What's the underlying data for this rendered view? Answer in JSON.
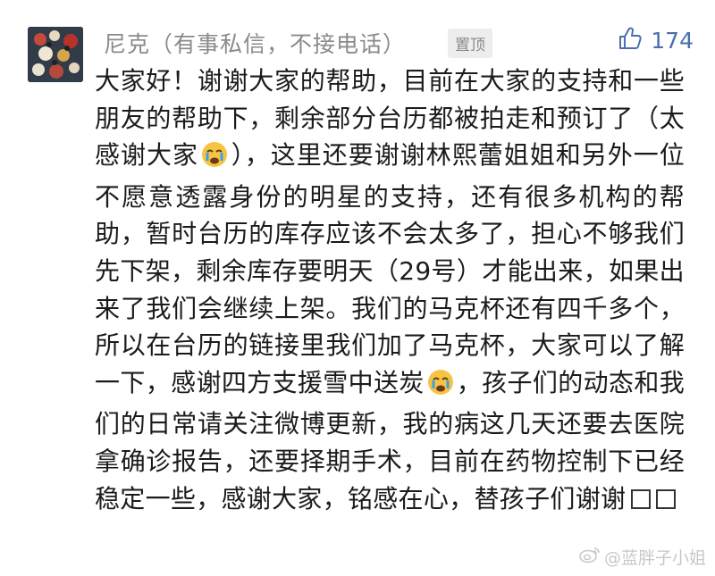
{
  "comment": {
    "author": {
      "name": "尼克（有事私信，不接电话）",
      "avatar_icon": "avatar-image"
    },
    "pin_label": "置顶",
    "likes": {
      "icon": "thumbs-up-icon",
      "count": "174"
    },
    "body_parts": [
      "大家好！谢谢大家的帮助，目前在大家的支持和一些朋友的帮助下，剩余部分台历都被拍走和预订了（太感谢大家",
      "），这里还要谢谢林熙蕾姐姐和另外一位不愿意透露身份的明星的支持，还有很多机构的帮助，暂时台历的库存应该不会太多了，担心不够我们先下架，剩余库存要明天（29号）才能出来，如果出来了我们会继续上架。我们的马克杯还有四千多个，所以在台历的链接里我们加了马克杯，大家可以了解一下，感谢四方支援雪中送炭",
      "，孩子们的动态和我们的日常请关注微博更新，我的病这几天还要去医院拿确诊报告，还要择期手术，目前在药物控制下已经稳定一些，感谢大家，铭感在心，替孩子们谢谢"
    ],
    "emoji_icon": "crying-face-emoji"
  },
  "watermark": {
    "icon": "weibo-logo-icon",
    "text": "@蓝胖子小姐"
  },
  "colors": {
    "like_accent": "#4a6fae",
    "meta_gray": "#8a8a8a",
    "badge_bg": "#ededed"
  }
}
